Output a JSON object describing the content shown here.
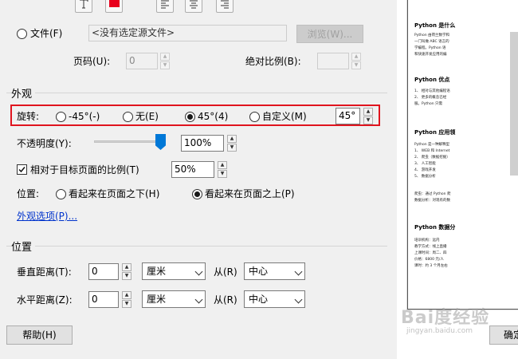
{
  "toolbar": {
    "text_icon": "T",
    "color_swatch": "#e8001c"
  },
  "source": {
    "file_label": "文件(F)",
    "file_value": "<没有选定源文件>",
    "browse_button": "浏览(W)...",
    "page_label": "页码(U):",
    "page_value": "0",
    "scale_label": "绝对比例(B):",
    "scale_value": ""
  },
  "appearance": {
    "title": "外观",
    "rotation_label": "旋转:",
    "rotation_options": [
      "-45°(-)",
      "无(E)",
      "45°(4)",
      "自定义(M)"
    ],
    "rotation_selected": "45°(4)",
    "rotation_custom_value": "45°",
    "opacity_label": "不透明度(Y):",
    "opacity_value": "100%",
    "opacity_level": 1.0,
    "relative_scale_label": "相对于目标页面的比例(T)",
    "relative_scale_checked": true,
    "relative_scale_value": "50%",
    "position_label": "位置:",
    "position_options": [
      "看起来在页面之下(H)",
      "看起来在页面之上(P)"
    ],
    "position_selected": "看起来在页面之上(P)",
    "options_link": "外观选项(P)...",
    "highlight_color": "#e0141e"
  },
  "position": {
    "title": "位置",
    "vertical_label": "垂直距离(T):",
    "vertical_value": "0",
    "vertical_unit": "厘米",
    "vertical_from_label": "从(R)",
    "vertical_from": "中心",
    "horizontal_label": "水平距离(Z):",
    "horizontal_value": "0",
    "horizontal_unit": "厘米",
    "horizontal_from_label": "从(R)",
    "horizontal_from": "中心"
  },
  "footer": {
    "help_button": "帮助(H)",
    "ok_button": "确定"
  },
  "preview": {
    "h1": "Python 是什么",
    "h1_lines": [
      "Python 由荷兰数学和",
      "一门叫做 ABC 语言的",
      "学编程。Python 语",
      "和快速开发应用的编"
    ],
    "h2": "Python 优点",
    "h2_lines": [
      "1、 相对与其他编程语",
      "2、 更多的概念已经",
      "   服。Python 只需"
    ],
    "h3": "Python 应用领",
    "h3_lines": [
      "Python 是一种解释型",
      "1、 WEB 和 Internet",
      "2、 爬虫（数据挖掘）",
      "3、 人工智能",
      "4、 游戏开发",
      "5、 数据分析"
    ],
    "h3_tail": [
      "爬虫：通过 Python 爬",
      "数据分析：对现有的数"
    ],
    "h4": "Python 数据分",
    "h4_lines": [
      "培训机构：远内",
      "教学方式：线上直播",
      "上课时间：周二、四",
      "价格：6800 元/人",
      "课时：约 3 个月左右"
    ]
  },
  "watermark": {
    "logo": "Bai度经验",
    "url": "jingyan.baidu.com"
  }
}
